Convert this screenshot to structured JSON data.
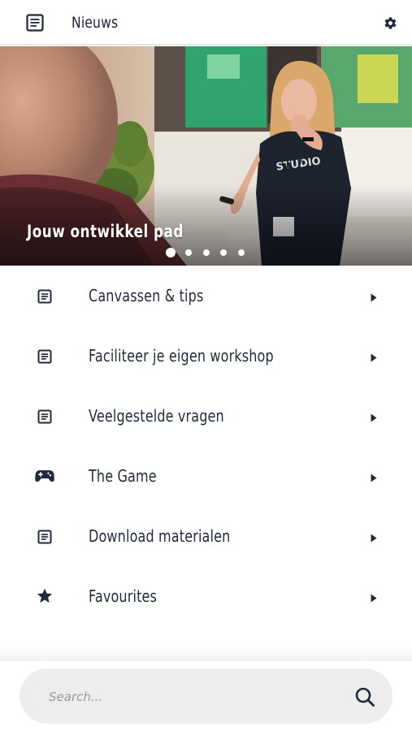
{
  "header": {
    "title": "Nieuws",
    "left_icon": "document-icon",
    "right_icon": "gear-icon"
  },
  "hero": {
    "caption": "Jouw ontwikkel pad",
    "slides_total": 5,
    "active_slide": 1
  },
  "menu": {
    "items": [
      {
        "label": "Canvassen & tips",
        "icon": "document-icon"
      },
      {
        "label": "Faciliteer je eigen workshop",
        "icon": "document-icon"
      },
      {
        "label": "Veelgestelde vragen",
        "icon": "document-icon"
      },
      {
        "label": "The Game",
        "icon": "gamepad-icon"
      },
      {
        "label": "Download materialen",
        "icon": "document-icon"
      },
      {
        "label": "Favourites",
        "icon": "star-icon"
      }
    ]
  },
  "search": {
    "placeholder": "Search..."
  },
  "colors": {
    "primary": "#1f2a3d",
    "search_bg": "#ededed",
    "header_border": "#e6e6e6"
  }
}
